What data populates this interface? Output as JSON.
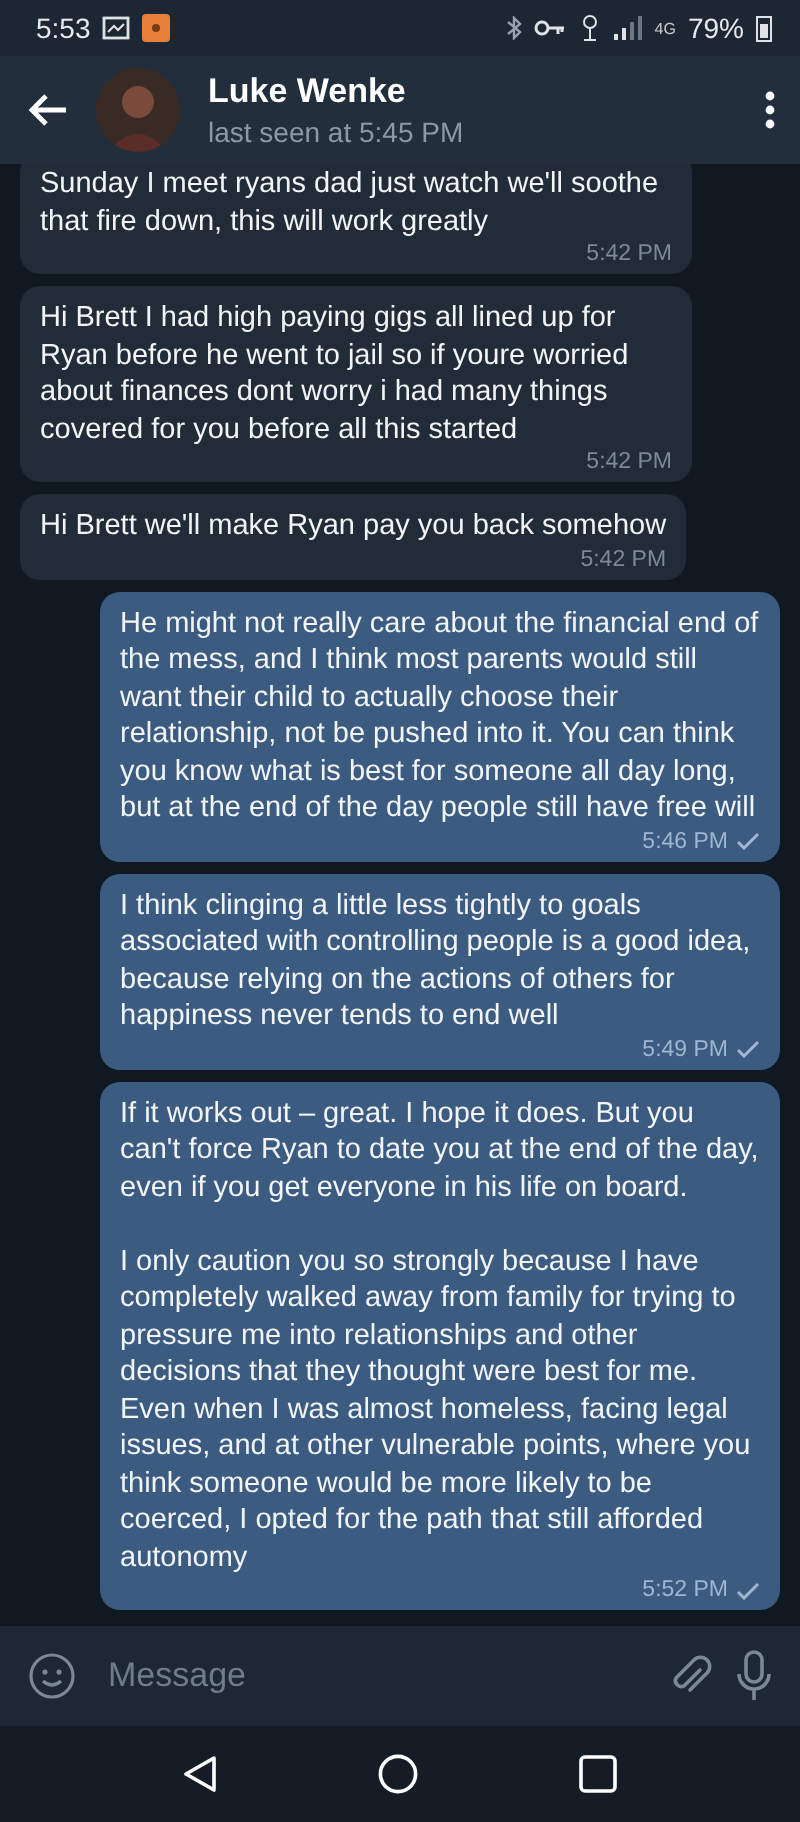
{
  "status_bar": {
    "time": "5:53",
    "network": "4G",
    "battery": "79%"
  },
  "header": {
    "name": "Luke Wenke",
    "last_seen": "last seen at 5:45 PM"
  },
  "messages": [
    {
      "kind": "incoming",
      "text": "Sunday I meet ryans dad just watch we'll soothe that fire down, this will work greatly",
      "time": "5:42 PM"
    },
    {
      "kind": "incoming",
      "text": "Hi Brett I had high paying gigs all lined up for Ryan before he went to jail so if youre worried about finances dont worry i had many things covered for you before all this started",
      "time": "5:42 PM"
    },
    {
      "kind": "incoming",
      "text": "Hi Brett we'll make Ryan pay you back somehow",
      "time": "5:42 PM"
    },
    {
      "kind": "outgoing",
      "text": "He might not really care about the financial end of the mess, and I think most parents would still want their child to actually choose their relationship, not be pushed into it. You can think you know what is best for someone all day long, but at the end of the day people still have free will",
      "time": "5:46 PM"
    },
    {
      "kind": "outgoing",
      "text": "I think clinging a little less tightly to goals associated with controlling people is a good idea, because relying on the actions of others for happiness never tends to end well",
      "time": "5:49 PM"
    },
    {
      "kind": "outgoing",
      "text": "If it works out – great. I hope it does. But you can't force Ryan to date you at the end of the day, even if you get everyone in his life on board.\n\nI only caution you so strongly because I have completely walked away from family for trying to pressure me into relationships and other decisions that they thought were best for me. Even when I was almost homeless, facing legal issues, and at other vulnerable points, where you think someone would be more likely to be coerced, I opted for the path that still afforded autonomy",
      "time": "5:52 PM"
    }
  ],
  "composer": {
    "placeholder": "Message"
  }
}
